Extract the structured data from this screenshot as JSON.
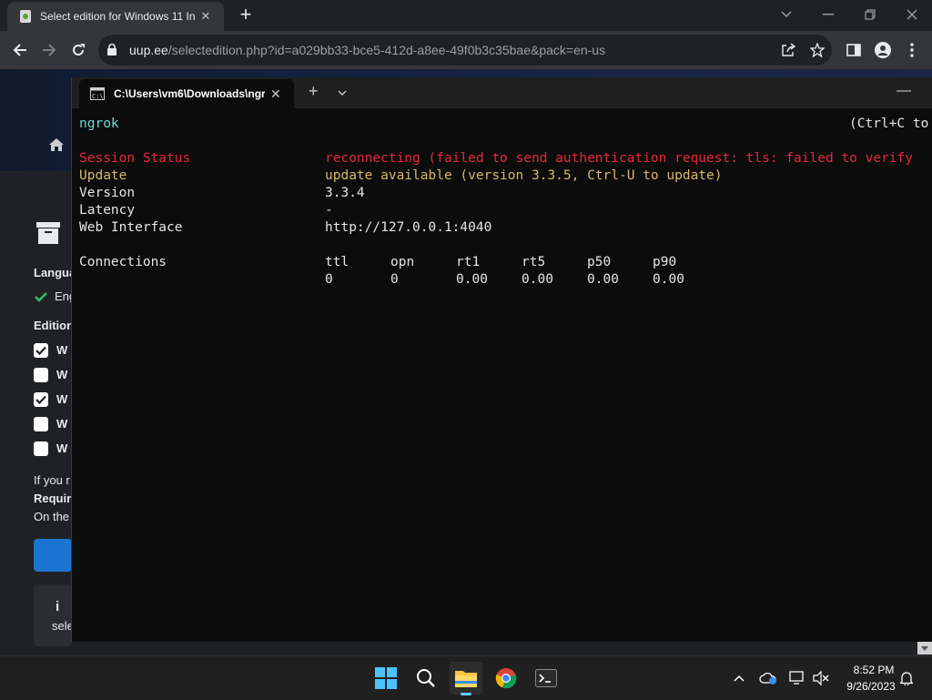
{
  "browser": {
    "tab_title": "Select edition for Windows 11 In",
    "url_host": "uup.ee",
    "url_path": "/selectedition.php?id=a029bb33-bce5-412d-a8ee-49f0b3c35bae&pack=en-us"
  },
  "page": {
    "lang_label": "Langua",
    "lang_value": "Eng",
    "edition_label": "Edition",
    "editions": [
      {
        "label": "W",
        "checked": true
      },
      {
        "label": "W",
        "checked": false
      },
      {
        "label": "W",
        "checked": true
      },
      {
        "label": "W",
        "checked": false
      },
      {
        "label": "W",
        "checked": false
      }
    ],
    "note_line1": "If you r",
    "note_line2": "Requir",
    "note_line3": "On the",
    "info_text": "sele"
  },
  "terminal": {
    "tab_title": "C:\\Users\\vm6\\Downloads\\ngr",
    "app_name": "ngrok",
    "quit_hint": "(Ctrl+C to",
    "rows": {
      "session_status_label": "Session Status",
      "session_status_value": "reconnecting (failed to send authentication request: tls: failed to verify",
      "update_label": "Update",
      "update_value": "update available (version 3.3.5, Ctrl-U to update)",
      "version_label": "Version",
      "version_value": "3.3.4",
      "latency_label": "Latency",
      "latency_value": "-",
      "web_label": "Web Interface",
      "web_value": "http://127.0.0.1:4040",
      "connections_label": "Connections"
    },
    "conn_headers": [
      "ttl",
      "opn",
      "rt1",
      "rt5",
      "p50",
      "p90"
    ],
    "conn_values": [
      "0",
      "0",
      "0.00",
      "0.00",
      "0.00",
      "0.00"
    ]
  },
  "taskbar": {
    "time": "8:52 PM",
    "date": "9/26/2023"
  },
  "colors": {
    "status_red": "#e8283a",
    "update_yellow": "#d7b86a",
    "accent_blue": "#1b75d0"
  }
}
